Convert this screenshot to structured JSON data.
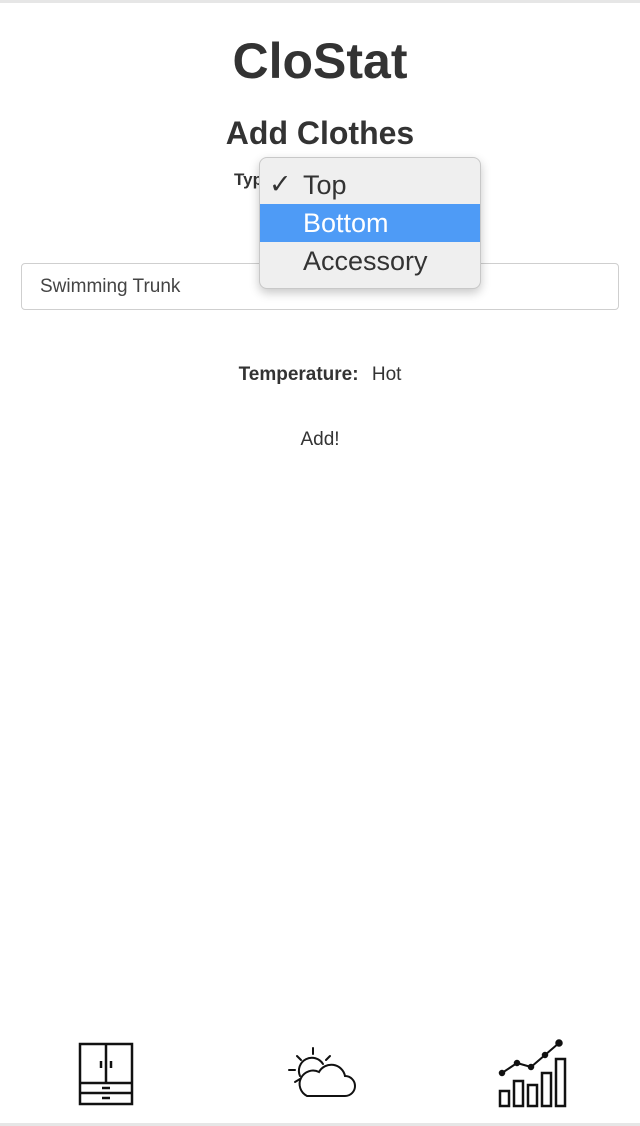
{
  "app": {
    "title": "CloStat"
  },
  "form": {
    "heading": "Add Clothes",
    "type_label": "Type:",
    "name_value": "Swimming Trunk",
    "temperature_label": "Temperature:",
    "temperature_value": "Hot",
    "add_label": "Add!"
  },
  "dropdown": {
    "selected": "Top",
    "highlighted": "Bottom",
    "options": [
      "Top",
      "Bottom",
      "Accessory"
    ],
    "checkmark": "✓",
    "highlight_color": "#4e9bf6"
  },
  "tabbar": {
    "items": [
      {
        "icon": "wardrobe-icon"
      },
      {
        "icon": "weather-icon"
      },
      {
        "icon": "stats-chart-icon"
      }
    ]
  }
}
